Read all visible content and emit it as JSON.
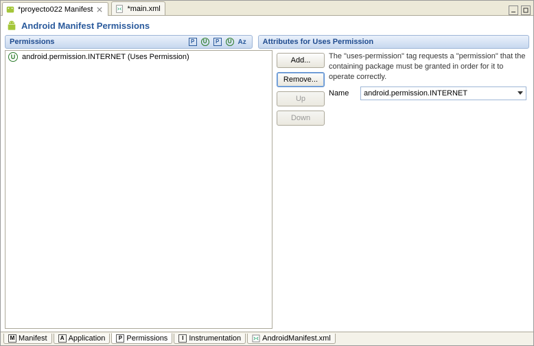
{
  "tabs": [
    {
      "label": "*proyecto022 Manifest",
      "active": true
    },
    {
      "label": "*main.xml",
      "active": false
    }
  ],
  "page_title": "Android Manifest Permissions",
  "left_section_title": "Permissions",
  "right_section_title": "Attributes for Uses Permission",
  "permissions_list": [
    {
      "label": "android.permission.INTERNET (Uses Permission)"
    }
  ],
  "buttons": {
    "add": "Add...",
    "remove": "Remove...",
    "up": "Up",
    "down": "Down"
  },
  "description": "The \"uses-permission\" tag requests a \"permission\" that the containing package must be granted in order for it to operate correctly.",
  "name_label": "Name",
  "name_value": "android.permission.INTERNET",
  "bottom_tabs": [
    {
      "letter": "M",
      "label": "Manifest"
    },
    {
      "letter": "A",
      "label": "Application"
    },
    {
      "letter": "P",
      "label": "Permissions",
      "active": true
    },
    {
      "letter": "I",
      "label": "Instrumentation"
    },
    {
      "letter": "",
      "label": "AndroidManifest.xml"
    }
  ],
  "tool_icons": {
    "p1": "P",
    "u1": "U",
    "p2": "P",
    "u2": "U",
    "az": "Az"
  }
}
